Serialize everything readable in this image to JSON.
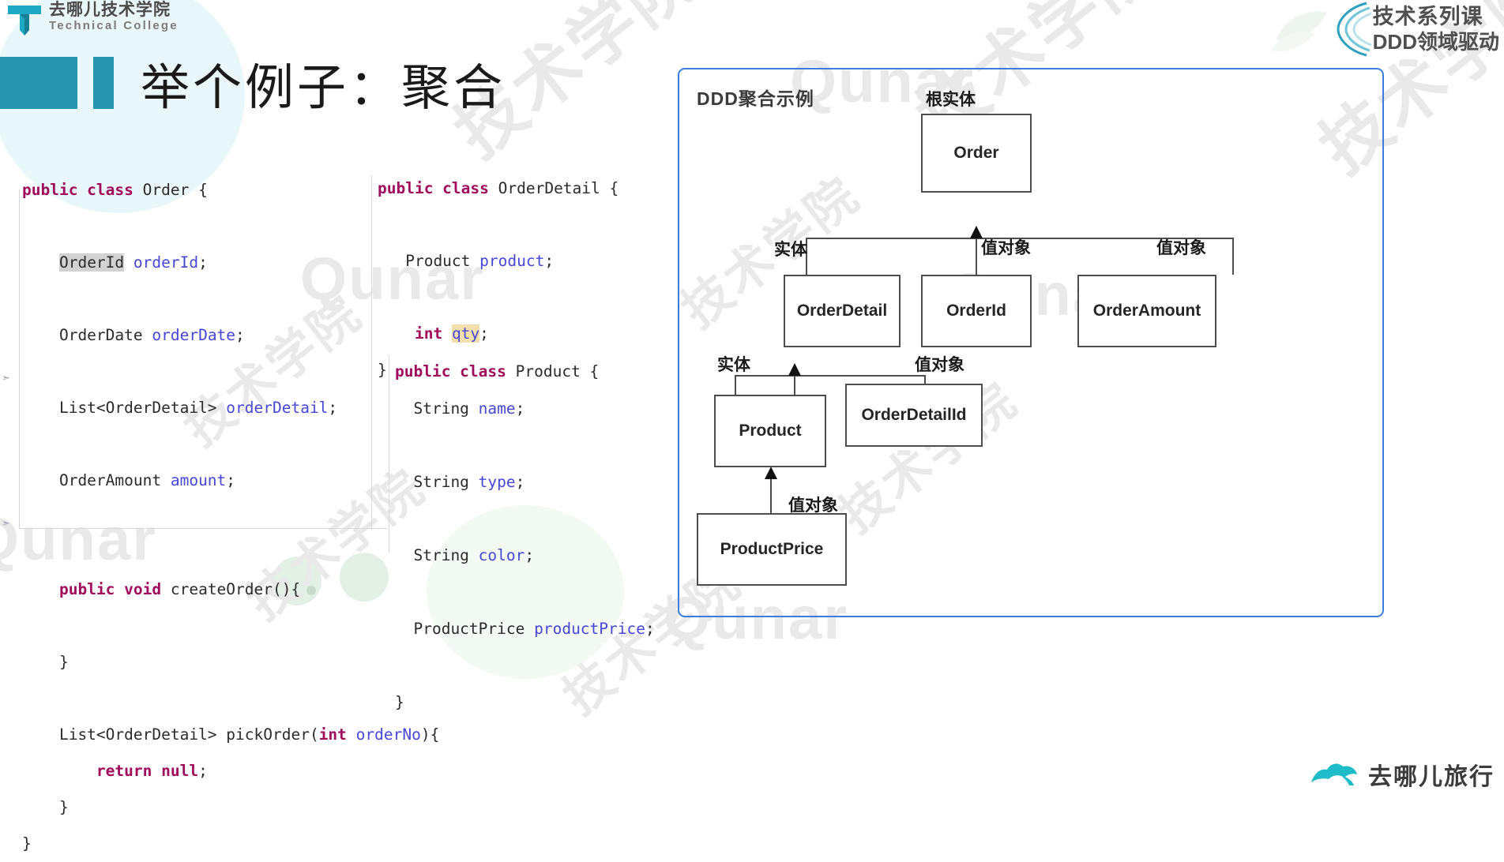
{
  "header": {
    "logo_cn": "去哪儿技术学院",
    "logo_en": "Technical College",
    "logo_icon": "qunar-t-mark-icon",
    "brand_line1": "技术系列课",
    "brand_line2": "DDD领域驱动",
    "brand_icon": "concentric-arcs-icon"
  },
  "title": "举个例子：聚合",
  "code_left": {
    "lines": [
      [
        {
          "t": "public class ",
          "c": "kw"
        },
        {
          "t": "Order {",
          "c": "ty"
        }
      ],
      [],
      [
        {
          "t": "    ",
          "c": "ty"
        },
        {
          "t": "OrderId",
          "c": "ty hl-g"
        },
        {
          "t": " ",
          "c": "ty"
        },
        {
          "t": "orderId",
          "c": "id"
        },
        {
          "t": ";",
          "c": "ty"
        }
      ],
      [],
      [
        {
          "t": "    OrderDate ",
          "c": "ty"
        },
        {
          "t": "orderDate",
          "c": "id"
        },
        {
          "t": ";",
          "c": "ty"
        }
      ],
      [],
      [
        {
          "t": "    List<OrderDetail> ",
          "c": "ty"
        },
        {
          "t": "orderDetail",
          "c": "id"
        },
        {
          "t": ";",
          "c": "ty"
        }
      ],
      [],
      [
        {
          "t": "    OrderAmount ",
          "c": "ty"
        },
        {
          "t": "amount",
          "c": "id"
        },
        {
          "t": ";",
          "c": "ty"
        }
      ],
      [],
      [],
      [
        {
          "t": "    ",
          "c": "ty"
        },
        {
          "t": "public void ",
          "c": "kw"
        },
        {
          "t": "createOrder(){",
          "c": "ty"
        }
      ],
      [],
      [
        {
          "t": "    }",
          "c": "ty"
        }
      ],
      [],
      [
        {
          "t": "    List<OrderDetail> pickOrder(",
          "c": "ty"
        },
        {
          "t": "int ",
          "c": "kw"
        },
        {
          "t": "orderNo",
          "c": "id"
        },
        {
          "t": "){",
          "c": "ty"
        }
      ],
      [
        {
          "t": "        ",
          "c": "ty"
        },
        {
          "t": "return null",
          "c": "kw"
        },
        {
          "t": ";",
          "c": "ty"
        }
      ],
      [
        {
          "t": "    }",
          "c": "ty"
        }
      ],
      [
        {
          "t": "}",
          "c": "ty"
        }
      ]
    ]
  },
  "code_mid": {
    "lines": [
      [
        {
          "t": "public class ",
          "c": "kw"
        },
        {
          "t": "OrderDetail {",
          "c": "ty"
        }
      ],
      [],
      [
        {
          "t": "   Product ",
          "c": "ty"
        },
        {
          "t": "product",
          "c": "id"
        },
        {
          "t": ";",
          "c": "ty"
        }
      ],
      [],
      [
        {
          "t": "    ",
          "c": "ty"
        },
        {
          "t": "int ",
          "c": "kw"
        },
        {
          "t": "qty",
          "c": "id hl-y"
        },
        {
          "t": ";",
          "c": "ty"
        }
      ],
      [
        {
          "t": "}",
          "c": "ty"
        }
      ]
    ]
  },
  "code_mid2": {
    "lines": [
      [
        {
          "t": "public class ",
          "c": "kw"
        },
        {
          "t": "Product {",
          "c": "ty"
        }
      ],
      [
        {
          "t": "  String ",
          "c": "ty"
        },
        {
          "t": "name",
          "c": "id"
        },
        {
          "t": ";",
          "c": "ty"
        }
      ],
      [],
      [
        {
          "t": "  String ",
          "c": "ty"
        },
        {
          "t": "type",
          "c": "id"
        },
        {
          "t": ";",
          "c": "ty"
        }
      ],
      [],
      [
        {
          "t": "  String ",
          "c": "ty"
        },
        {
          "t": "color",
          "c": "id"
        },
        {
          "t": ";",
          "c": "ty"
        }
      ],
      [],
      [
        {
          "t": "  ProductPrice ",
          "c": "ty"
        },
        {
          "t": "productPrice",
          "c": "id"
        },
        {
          "t": ";",
          "c": "ty"
        }
      ],
      [],
      [
        {
          "t": "}",
          "c": "ty"
        }
      ]
    ]
  },
  "diagram": {
    "title": "DDD聚合示例",
    "border_color": "#3b7ddd",
    "nodes": [
      {
        "id": "order",
        "label": "Order"
      },
      {
        "id": "orderdetail",
        "label": "OrderDetail"
      },
      {
        "id": "orderid",
        "label": "OrderId"
      },
      {
        "id": "orderamount",
        "label": "OrderAmount"
      },
      {
        "id": "product",
        "label": "Product"
      },
      {
        "id": "orderdetailid",
        "label": "OrderDetailId"
      },
      {
        "id": "productprice",
        "label": "ProductPrice"
      }
    ],
    "tags": [
      {
        "id": "root",
        "label": "根实体"
      },
      {
        "id": "entity1",
        "label": "实体"
      },
      {
        "id": "vo1",
        "label": "值对象"
      },
      {
        "id": "vo2",
        "label": "值对象"
      },
      {
        "id": "entity2",
        "label": "实体"
      },
      {
        "id": "vo3",
        "label": "值对象"
      },
      {
        "id": "vo4",
        "label": "值对象"
      }
    ]
  },
  "watermarks": {
    "qunar": "Qunar",
    "cn": "技术学院"
  },
  "footer": {
    "logo_text": "去哪儿旅行",
    "logo_icon": "camel-icon"
  }
}
